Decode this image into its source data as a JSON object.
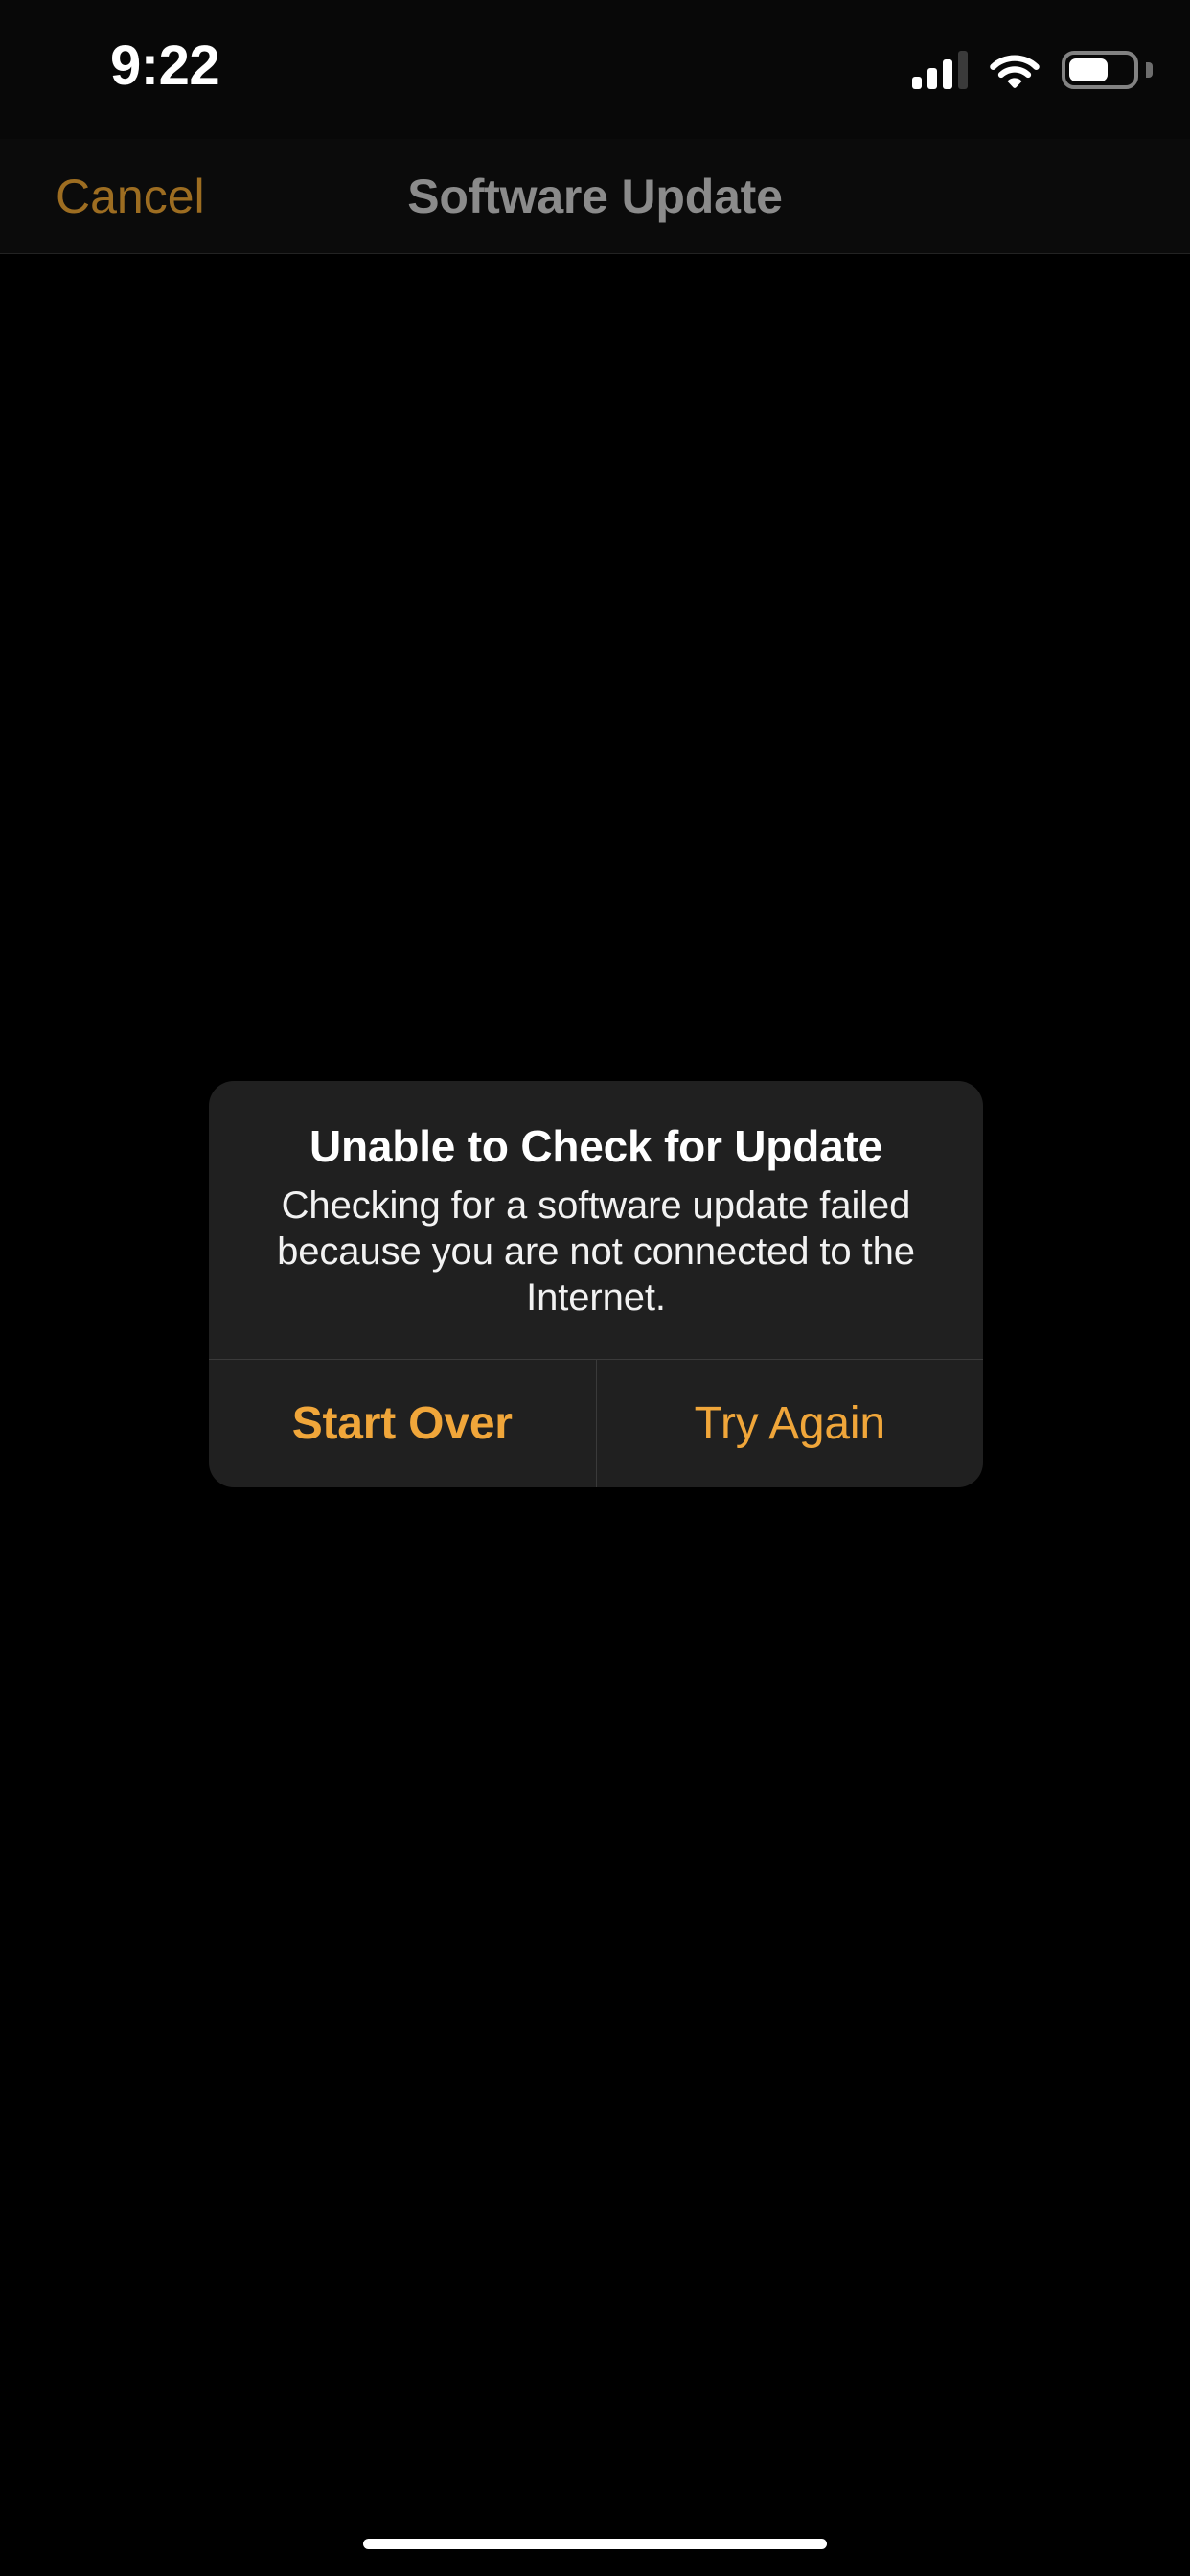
{
  "status_bar": {
    "time": "9:22",
    "cellular_icon": "cellular-signal-icon",
    "cellular_bars_filled": 3,
    "cellular_bars_total": 4,
    "wifi_icon": "wifi-icon",
    "wifi_strength": "full",
    "battery_icon": "battery-icon",
    "battery_level_percent": 62
  },
  "nav_bar": {
    "cancel_label": "Cancel",
    "title": "Software Update"
  },
  "alert": {
    "title": "Unable to Check for Update",
    "message": "Checking for a software update failed because you are not connected to the Internet.",
    "actions": [
      {
        "label": "Start Over",
        "style": "default-bold"
      },
      {
        "label": "Try Again",
        "style": "regular"
      }
    ]
  },
  "home_indicator": {
    "name": "home-indicator"
  },
  "colors": {
    "background": "#000000",
    "nav_background": "#0b0b0b",
    "accent_orange": "#f0a63a",
    "accent_orange_dim": "#9d6d21",
    "alert_background": "#202020",
    "alert_divider": "#3a3a3a",
    "title_gray": "#8b8b8b",
    "text_white": "#ffffff"
  }
}
